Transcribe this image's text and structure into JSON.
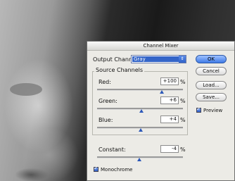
{
  "dialog": {
    "title": "Channel Mixer",
    "output_channel_label": "Output Channel:",
    "output_channel_value": "Gray",
    "source_channels_label": "Source Channels",
    "red_label": "Red:",
    "red_value": "+100",
    "green_label": "Green:",
    "green_value": "+6",
    "blue_label": "Blue:",
    "blue_value": "+4",
    "constant_label": "Constant:",
    "constant_value": "-4",
    "percent": "%",
    "monochrome_label": "Monochrome",
    "monochrome_checked": true
  },
  "buttons": {
    "ok": "OK",
    "cancel": "Cancel",
    "load": "Load...",
    "save": "Save..."
  },
  "preview": {
    "label": "Preview",
    "checked": true
  },
  "sliders": {
    "red": 100,
    "green": 6,
    "blue": 4,
    "constant": -4
  }
}
